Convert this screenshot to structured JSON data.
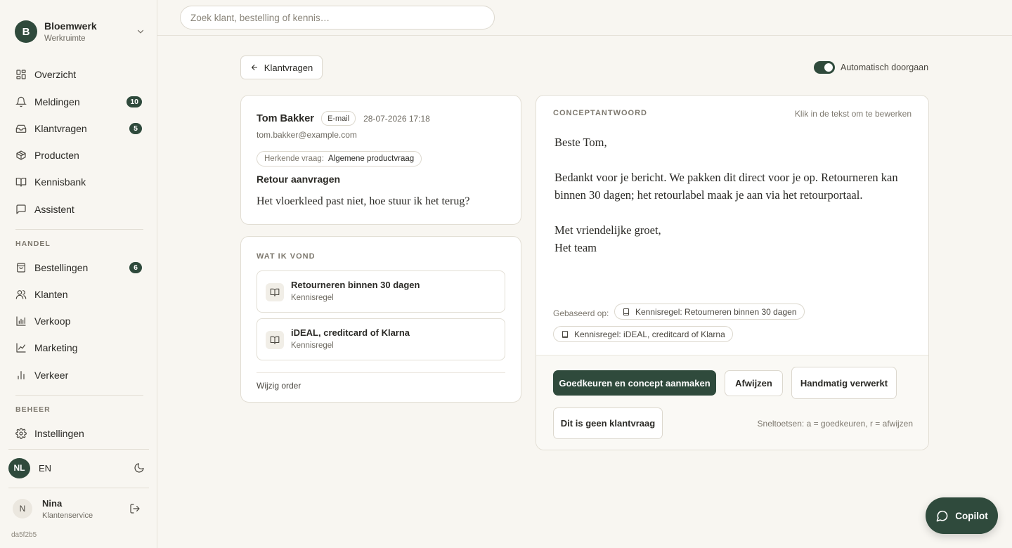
{
  "workspace": {
    "initial": "B",
    "name": "Bloemwerk",
    "subtitle": "Werkruimte",
    "icon": "chevron-down-icon"
  },
  "nav": {
    "main": [
      {
        "label": "Overzicht",
        "icon": "grid-icon"
      },
      {
        "label": "Meldingen",
        "icon": "bell-icon",
        "badge": "10"
      },
      {
        "label": "Klantvragen",
        "icon": "inbox-icon",
        "badge": "5"
      },
      {
        "label": "Producten",
        "icon": "package-icon"
      },
      {
        "label": "Kennisbank",
        "icon": "book-icon"
      },
      {
        "label": "Assistent",
        "icon": "chat-icon"
      }
    ],
    "handel_label": "HANDEL",
    "handel": [
      {
        "label": "Bestellingen",
        "icon": "shopping-bag-icon",
        "badge": "6"
      },
      {
        "label": "Klanten",
        "icon": "users-icon"
      },
      {
        "label": "Verkoop",
        "icon": "bar-chart-icon"
      },
      {
        "label": "Marketing",
        "icon": "line-chart-icon"
      },
      {
        "label": "Verkeer",
        "icon": "stats-icon"
      }
    ],
    "beheer_label": "BEHEER",
    "beheer": [
      {
        "label": "Instellingen",
        "icon": "gear-icon"
      }
    ]
  },
  "language": {
    "active": "NL",
    "other": "EN",
    "theme_icon": "moon-icon"
  },
  "user": {
    "initial": "N",
    "name": "Nina",
    "role": "Klantenservice",
    "logout_icon": "logout-icon"
  },
  "build": "da5f2b5",
  "search": {
    "placeholder": "Zoek klant, bestelling of kennis…",
    "value": ""
  },
  "back_button": {
    "label": "Klantvragen",
    "icon": "arrow-left-icon"
  },
  "auto_toggle": {
    "label": "Automatisch doorgaan",
    "on": true
  },
  "message": {
    "sender": "Tom Bakker",
    "channel": "E-mail",
    "timestamp": "28-07-2026 17:18",
    "email": "tom.bakker@example.com",
    "intent_key": "Herkende vraag:",
    "intent_value": "Algemene productvraag",
    "subject": "Retour aanvragen",
    "body": "Het vloerkleed past niet, hoe stuur ik het terug?"
  },
  "found": {
    "heading": "WAT IK VOND",
    "items": [
      {
        "title": "Retourneren binnen 30 dagen",
        "type": "Kennisregel",
        "icon": "book-icon"
      },
      {
        "title": "iDEAL, creditcard of Klarna",
        "type": "Kennisregel",
        "icon": "book-icon"
      }
    ],
    "change_order": "Wijzig order"
  },
  "draft": {
    "heading": "CONCEPTANTWOORD",
    "hint": "Klik in de tekst om te bewerken",
    "greeting": "Beste Tom,",
    "paragraph": "Bedankt voor je bericht. We pakken dit direct voor je op. Retourneren kan binnen 30 dagen; het retourlabel maak je aan via het retourportaal.",
    "closing_1": "Met vriendelijke groet,",
    "closing_2": "Het team",
    "based_on_label": "Gebaseerd op:",
    "sources": [
      "Kennisregel: Retourneren binnen 30 dagen",
      "Kennisregel: iDEAL, creditcard of Klarna"
    ]
  },
  "actions": {
    "approve": "Goedkeuren en concept aanmaken",
    "reject": "Afwijzen",
    "manual": "Handmatig verwerkt",
    "not_question": "Dit is geen klantvraag",
    "shortcuts": "Sneltoetsen: a = goedkeuren, r = afwijzen"
  },
  "copilot": {
    "label": "Copilot",
    "icon": "chat-bubble-icon"
  },
  "colors": {
    "accent": "#2f4a3c",
    "background": "#f8f6f1",
    "card": "#ffffff"
  }
}
